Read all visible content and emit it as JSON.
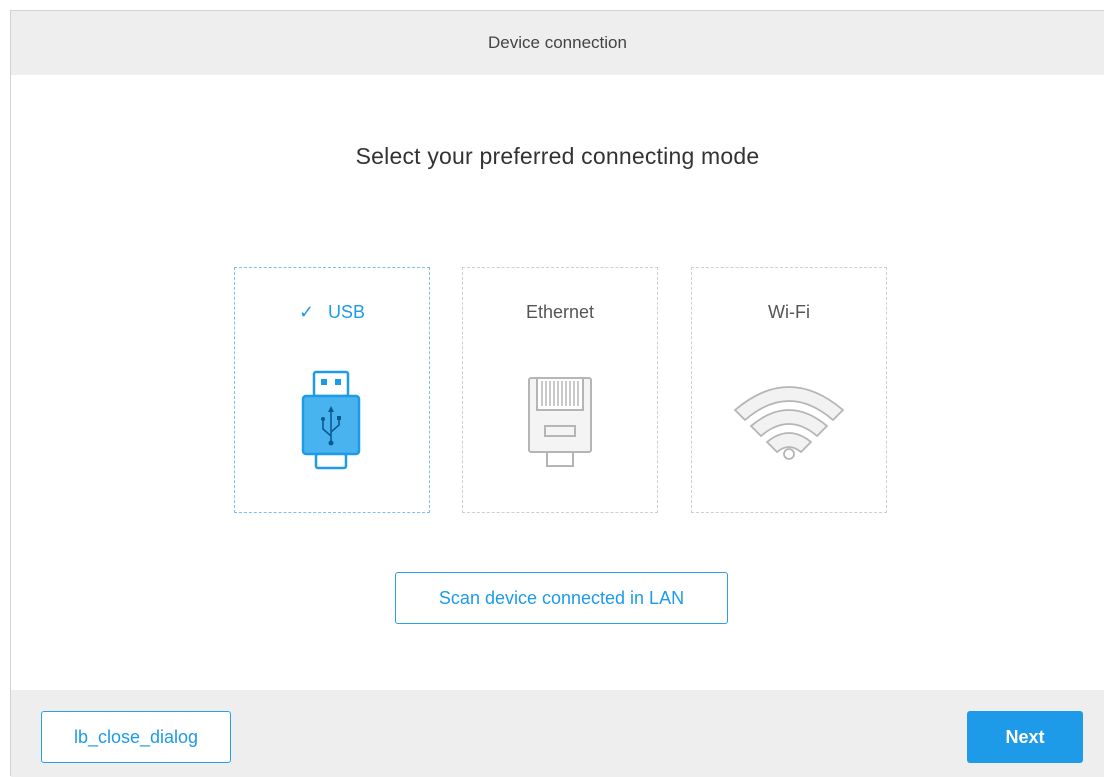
{
  "dialog": {
    "title": "Device connection",
    "heading": "Select your preferred connecting mode"
  },
  "modes": {
    "usb": {
      "label": "USB",
      "selected": true,
      "icon": "usb-icon"
    },
    "ethernet": {
      "label": "Ethernet",
      "selected": false,
      "icon": "ethernet-icon"
    },
    "wifi": {
      "label": "Wi-Fi",
      "selected": false,
      "icon": "wifi-icon"
    }
  },
  "scan_button": {
    "label": "Scan device connected in LAN"
  },
  "footer": {
    "close_label": "lb_close_dialog",
    "next_label": "Next"
  },
  "colors": {
    "accent": "#1e9be8",
    "neutral_icon": "#b5b5b5",
    "title_bar": "#eeeeee"
  }
}
